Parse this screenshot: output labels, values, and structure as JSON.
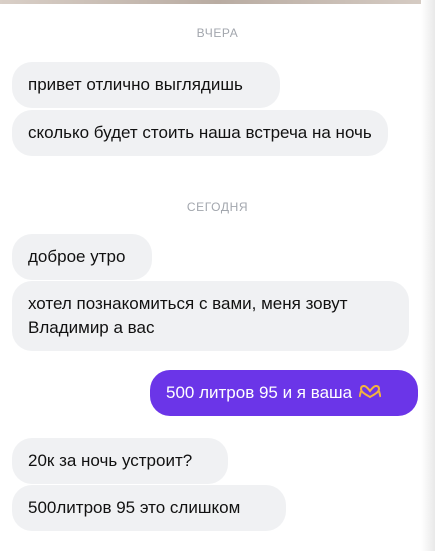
{
  "chat": {
    "separators": {
      "yesterday": "ВЧЕРА",
      "today": "СЕГОДНЯ"
    },
    "messages": {
      "m1": "привет отлично выглядишь",
      "m2": "сколько будет стоить наша встреча на ночь",
      "m3": "доброе утро",
      "m4": "хотел познакомиться с вами, меня зовут Владимир а вас",
      "m5": "500 литров 95 и я ваша",
      "m6": "20к за ночь устроит?",
      "m7": "500литров 95 это слишком"
    },
    "emoji": "heart-hands-emoji",
    "colors": {
      "incoming_bubble": "#f0f1f3",
      "outgoing_bubble": "#6b35e8",
      "separator_text": "#a2a6ad"
    }
  }
}
